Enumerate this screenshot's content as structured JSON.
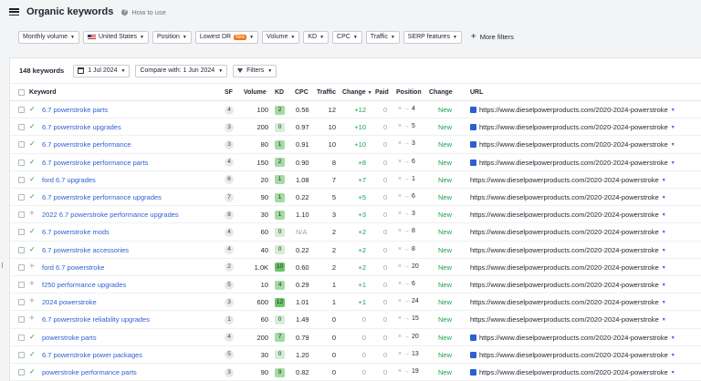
{
  "header": {
    "title": "Organic keywords",
    "help": "How to use"
  },
  "filters": [
    {
      "label": "Monthly volume"
    },
    {
      "label": "United States",
      "flag": true
    },
    {
      "label": "Position"
    },
    {
      "label": "Lowest DR",
      "badge": "New"
    },
    {
      "label": "Volume"
    },
    {
      "label": "KD"
    },
    {
      "label": "CPC"
    },
    {
      "label": "Traffic"
    },
    {
      "label": "SERP features"
    }
  ],
  "more_filters": "More filters",
  "summary": {
    "count": "148 keywords",
    "date": "1 Jul 2024",
    "compare": "Compare with: 1 Jun 2024",
    "filters": "Filters"
  },
  "columns": {
    "keyword": "Keyword",
    "sf": "SF",
    "volume": "Volume",
    "kd": "KD",
    "cpc": "CPC",
    "traffic": "Traffic",
    "change": "Change",
    "paid": "Paid",
    "position": "Position",
    "change2": "Change",
    "url": "URL"
  },
  "kd_colors": {
    "green_light": "#d4eed3",
    "green_mid": "#a5dba3",
    "green_dark": "#6cc46a"
  },
  "rows": [
    {
      "kw": "6.7 powerstroke parts",
      "mark": "check",
      "sf": "4",
      "vol": "100",
      "kd": "2",
      "kdc": "#a5dba3",
      "cpc": "0.56",
      "traffic": "12",
      "change": "+12",
      "paid": "0",
      "from": "×",
      "pos": "4",
      "status": "New",
      "url": "https://www.dieselpowerproducts.com/2020-2024-powerstroke",
      "icon": true
    },
    {
      "kw": "6.7 powerstroke upgrades",
      "mark": "check",
      "sf": "3",
      "vol": "200",
      "kd": "0",
      "kdc": "#d4eed3",
      "cpc": "0.97",
      "traffic": "10",
      "change": "+10",
      "paid": "0",
      "from": "×",
      "pos": "5",
      "status": "New",
      "url": "https://www.dieselpowerproducts.com/2020-2024-powerstroke",
      "icon": true
    },
    {
      "kw": "6.7 powerstroke performance",
      "mark": "check",
      "sf": "3",
      "vol": "80",
      "kd": "1",
      "kdc": "#a5dba3",
      "cpc": "0.91",
      "traffic": "10",
      "change": "+10",
      "paid": "0",
      "from": "×",
      "pos": "3",
      "status": "New",
      "url": "https://www.dieselpowerproducts.com/2020-2024-powerstroke",
      "icon": true
    },
    {
      "kw": "6.7 powerstroke performance parts",
      "mark": "check",
      "sf": "4",
      "vol": "150",
      "kd": "2",
      "kdc": "#a5dba3",
      "cpc": "0.90",
      "traffic": "8",
      "change": "+8",
      "paid": "0",
      "from": "×",
      "pos": "6",
      "status": "New",
      "url": "https://www.dieselpowerproducts.com/2020-2024-powerstroke",
      "icon": true
    },
    {
      "kw": "ford 6.7 upgrades",
      "mark": "check",
      "sf": "6",
      "vol": "20",
      "kd": "1",
      "kdc": "#a5dba3",
      "cpc": "1.08",
      "traffic": "7",
      "change": "+7",
      "paid": "0",
      "from": "×",
      "pos": "1",
      "status": "New",
      "url": "https://www.dieselpowerproducts.com/2020-2024-powerstroke",
      "icon": false
    },
    {
      "kw": "6.7 powerstroke performance upgrades",
      "mark": "check",
      "sf": "7",
      "vol": "90",
      "kd": "1",
      "kdc": "#a5dba3",
      "cpc": "0.22",
      "traffic": "5",
      "change": "+5",
      "paid": "0",
      "from": "×",
      "pos": "6",
      "status": "New",
      "url": "https://www.dieselpowerproducts.com/2020-2024-powerstroke",
      "icon": false
    },
    {
      "kw": "2022 6.7 powerstroke performance upgrades",
      "mark": "plus",
      "sf": "8",
      "vol": "30",
      "kd": "1",
      "kdc": "#a5dba3",
      "cpc": "1.10",
      "traffic": "3",
      "change": "+3",
      "paid": "0",
      "from": "×",
      "pos": "3",
      "status": "New",
      "url": "https://www.dieselpowerproducts.com/2020-2024-powerstroke",
      "icon": false
    },
    {
      "kw": "6.7 powerstroke mods",
      "mark": "check",
      "sf": "4",
      "vol": "60",
      "kd": "0",
      "kdc": "#d4eed3",
      "cpc": "N/A",
      "traffic": "2",
      "change": "+2",
      "paid": "0",
      "from": "×",
      "pos": "8",
      "status": "New",
      "url": "https://www.dieselpowerproducts.com/2020-2024-powerstroke",
      "icon": false
    },
    {
      "kw": "6.7 powerstroke accessories",
      "mark": "check",
      "sf": "4",
      "vol": "40",
      "kd": "0",
      "kdc": "#d4eed3",
      "cpc": "0.22",
      "traffic": "2",
      "change": "+2",
      "paid": "0",
      "from": "×",
      "pos": "8",
      "status": "New",
      "url": "https://www.dieselpowerproducts.com/2020-2024-powerstroke",
      "icon": false
    },
    {
      "kw": "ford 6.7 powerstroke",
      "mark": "plus",
      "sf": "2",
      "vol": "1.0K",
      "kd": "10",
      "kdc": "#6cc46a",
      "cpc": "0.60",
      "traffic": "2",
      "change": "+2",
      "paid": "0",
      "from": "×",
      "pos": "20",
      "status": "New",
      "url": "https://www.dieselpowerproducts.com/2020-2024-powerstroke",
      "icon": false
    },
    {
      "kw": "f250 performance upgrades",
      "mark": "plus",
      "sf": "5",
      "vol": "10",
      "kd": "4",
      "kdc": "#a5dba3",
      "cpc": "0.29",
      "traffic": "1",
      "change": "+1",
      "paid": "0",
      "from": "×",
      "pos": "6",
      "status": "New",
      "url": "https://www.dieselpowerproducts.com/2020-2024-powerstroke",
      "icon": false
    },
    {
      "kw": "2024 powerstroke",
      "mark": "plus",
      "sf": "3",
      "vol": "600",
      "kd": "12",
      "kdc": "#6cc46a",
      "cpc": "1.01",
      "traffic": "1",
      "change": "+1",
      "paid": "0",
      "from": "×",
      "pos": "24",
      "status": "New",
      "url": "https://www.dieselpowerproducts.com/2020-2024-powerstroke",
      "icon": false
    },
    {
      "kw": "6.7 powerstroke reliability upgrades",
      "mark": "plus",
      "sf": "1",
      "vol": "60",
      "kd": "0",
      "kdc": "#d4eed3",
      "cpc": "1.49",
      "traffic": "0",
      "change": "0",
      "paid": "0",
      "from": "×",
      "pos": "15",
      "status": "New",
      "url": "https://www.dieselpowerproducts.com/2020-2024-powerstroke",
      "icon": false
    },
    {
      "kw": "powerstroke parts",
      "mark": "check",
      "sf": "4",
      "vol": "200",
      "kd": "7",
      "kdc": "#a5dba3",
      "cpc": "0.79",
      "traffic": "0",
      "change": "0",
      "paid": "0",
      "from": "×",
      "pos": "20",
      "status": "New",
      "url": "https://www.dieselpowerproducts.com/2020-2024-powerstroke",
      "icon": true
    },
    {
      "kw": "6.7 powerstroke power packages",
      "mark": "check",
      "sf": "5",
      "vol": "30",
      "kd": "0",
      "kdc": "#d4eed3",
      "cpc": "1.20",
      "traffic": "0",
      "change": "0",
      "paid": "0",
      "from": "×",
      "pos": "13",
      "status": "New",
      "url": "https://www.dieselpowerproducts.com/2020-2024-powerstroke",
      "icon": true
    },
    {
      "kw": "powerstroke performance parts",
      "mark": "check",
      "sf": "3",
      "vol": "90",
      "kd": "9",
      "kdc": "#a5dba3",
      "cpc": "0.82",
      "traffic": "0",
      "change": "0",
      "paid": "0",
      "from": "×",
      "pos": "19",
      "status": "New",
      "url": "https://www.dieselpowerproducts.com/2020-2024-powerstroke",
      "icon": true
    }
  ]
}
